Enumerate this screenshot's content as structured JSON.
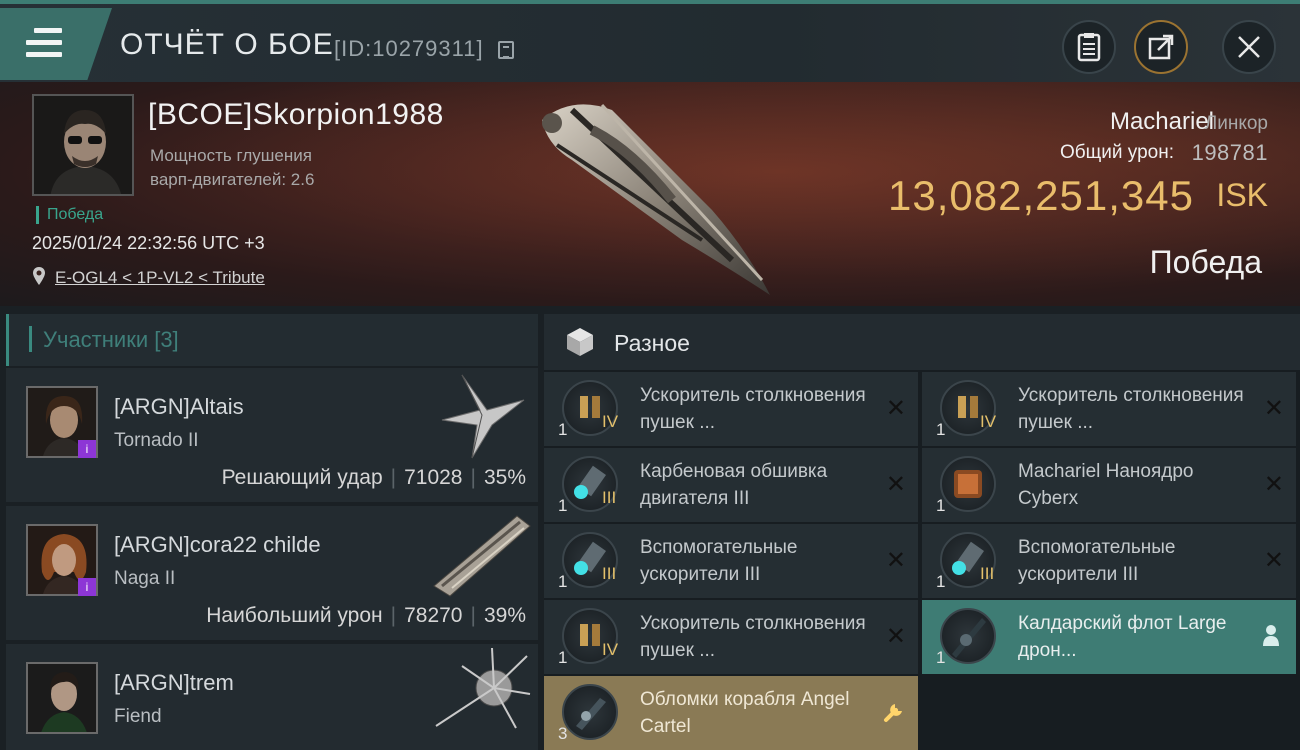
{
  "header": {
    "title": "ОТЧЁТ О БОЕ",
    "report_id": "[ID:10279311]",
    "icons": [
      "menu-icon",
      "copy-icon",
      "clipboard-icon",
      "share-icon",
      "close-icon"
    ]
  },
  "victim": {
    "name": "[BCOE]Skorpion1988",
    "warp_label": "Мощность глушения варп-двигателей: 2.6",
    "result_tag": "Победа",
    "datetime": "2025/01/24 22:32:56 UTC +3",
    "location": "E-OGL4 < 1P-VL2 < Tribute",
    "ship_name": "Machariel",
    "ship_class": "Линкор",
    "damage_label": "Общий урон:",
    "damage_value": "198781",
    "isk_value": "13,082,251,345",
    "isk_unit": "ISK",
    "result": "Победа"
  },
  "participants": {
    "header": "Участники [3]",
    "items": [
      {
        "name": "[ARGN]Altais",
        "ship": "Tornado II",
        "role": "Решающий удар",
        "damage": "71028",
        "percent": "35%"
      },
      {
        "name": "[ARGN]cora22 childe",
        "ship": "Naga II",
        "role": "Наибольший урон",
        "damage": "78270",
        "percent": "39%"
      },
      {
        "name": "[ARGN]trem",
        "ship": "Fiend",
        "role": "",
        "damage": "",
        "percent": ""
      }
    ]
  },
  "misc": {
    "header": "Разное",
    "items": [
      {
        "name": "Ускоритель столкновения пушек ...",
        "qty": "1",
        "level": "IV",
        "status": "destroyed"
      },
      {
        "name": "Ускоритель столкновения пушек ...",
        "qty": "1",
        "level": "IV",
        "status": "destroyed"
      },
      {
        "name": "Карбеновая обшивка двигателя III",
        "qty": "1",
        "level": "III",
        "status": "destroyed"
      },
      {
        "name": "Machariel Наноядро Cyberx",
        "qty": "1",
        "level": "",
        "status": "destroyed"
      },
      {
        "name": "Вспомогательные ускорители III",
        "qty": "1",
        "level": "III",
        "status": "destroyed"
      },
      {
        "name": "Вспомогательные ускорители III",
        "qty": "1",
        "level": "III",
        "status": "destroyed"
      },
      {
        "name": "Ускоритель столкновения пушек ...",
        "qty": "1",
        "level": "IV",
        "status": "destroyed"
      },
      {
        "name": "Калдарский флот Large дрон...",
        "qty": "1",
        "level": "",
        "status": "dropped"
      },
      {
        "name": "Обломки корабля Angel Cartel",
        "qty": "3",
        "level": "",
        "status": "salvage"
      }
    ]
  }
}
